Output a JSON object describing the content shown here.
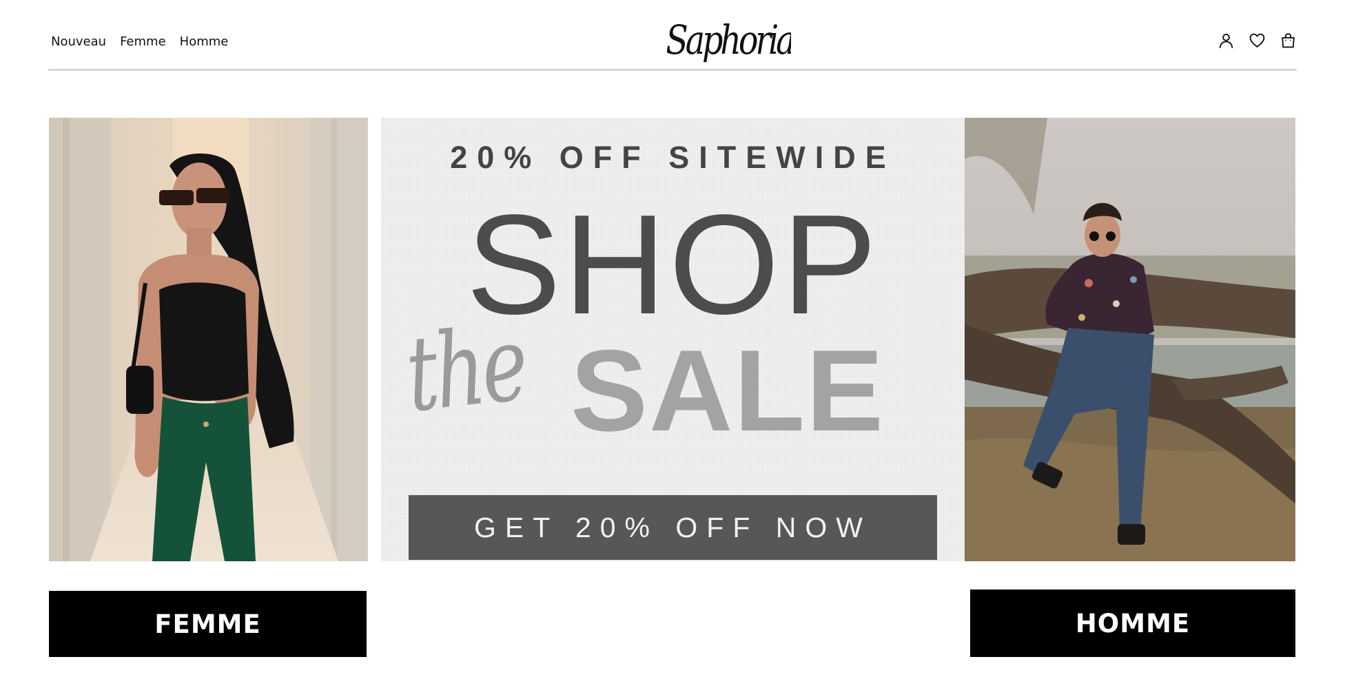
{
  "header": {
    "nav": [
      {
        "label": "Nouveau"
      },
      {
        "label": "Femme"
      },
      {
        "label": "Homme"
      }
    ],
    "logo": "Saphoria",
    "icons": [
      "account-icon",
      "heart-icon",
      "bag-icon"
    ]
  },
  "hero": {
    "left_photo": "woman-in-sunglasses-photo",
    "right_photo": "man-sitting-on-tree-trunk-photo",
    "banner": {
      "top_line": "20% OFF SITEWIDE",
      "headline_shop": "SHOP",
      "headline_the": "the",
      "headline_sale": "SALE",
      "cta": "GET 20% OFF NOW"
    }
  },
  "categories": {
    "femme_label": "FEMME",
    "homme_label": "HOMME"
  },
  "colors": {
    "text": "#111111",
    "banner_cta_bg": "#575757",
    "category_button_bg": "#000000",
    "divider": "#9a9a9a"
  }
}
